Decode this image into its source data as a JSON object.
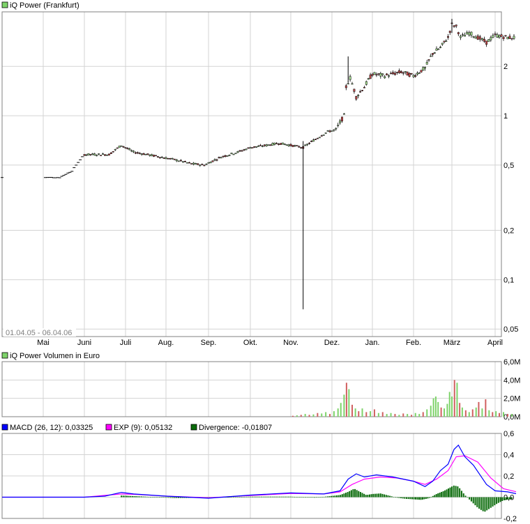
{
  "colors": {
    "grid": "#d3d3d3",
    "frame": "#808080",
    "candle_up": "#a6e08f",
    "candle_down": "#c44a4a",
    "volume_up": "#7ed36a",
    "volume_down": "#d06060",
    "macd": "#0000ff",
    "exp": "#ff00ff",
    "divergence": "#0a6b0a",
    "legend_price": "#7ed36a",
    "legend_volume": "#7ed36a"
  },
  "chart_data": [
    {
      "type": "candlestick",
      "title": "iQ Power (Frankfurt)",
      "date_range": "01.04.05 - 06.04.06",
      "y_scale": "log",
      "y_ticks": [
        {
          "value": 0.05,
          "label": "0,05"
        },
        {
          "value": 0.1,
          "label": "0,1"
        },
        {
          "value": 0.2,
          "label": "0,2"
        },
        {
          "value": 0.5,
          "label": "0,5"
        },
        {
          "value": 1,
          "label": "1"
        },
        {
          "value": 2,
          "label": "2"
        }
      ],
      "ylim": [
        0.045,
        4.3
      ],
      "months": [
        "Mai",
        "Juni",
        "Juli",
        "Aug.",
        "Sep.",
        "Okt.",
        "Nov.",
        "Dez.",
        "Jan.",
        "Feb.",
        "März",
        "April"
      ],
      "price_path": [
        {
          "x": 0,
          "y": 0.42
        },
        {
          "x": 0.4,
          "y": 0.42
        },
        {
          "x": 0.7,
          "y": 0.46
        },
        {
          "x": 1.0,
          "y": 0.58
        },
        {
          "x": 1.3,
          "y": 0.58
        },
        {
          "x": 1.6,
          "y": 0.58
        },
        {
          "x": 1.9,
          "y": 0.66
        },
        {
          "x": 2.2,
          "y": 0.6
        },
        {
          "x": 2.7,
          "y": 0.57
        },
        {
          "x": 3.2,
          "y": 0.54
        },
        {
          "x": 3.6,
          "y": 0.51
        },
        {
          "x": 3.9,
          "y": 0.5
        },
        {
          "x": 4.3,
          "y": 0.56
        },
        {
          "x": 4.7,
          "y": 0.6
        },
        {
          "x": 5.0,
          "y": 0.64
        },
        {
          "x": 5.4,
          "y": 0.66
        },
        {
          "x": 5.7,
          "y": 0.68
        },
        {
          "x": 6.0,
          "y": 0.66
        },
        {
          "x": 6.3,
          "y": 0.64
        },
        {
          "x": 6.6,
          "y": 0.72
        },
        {
          "x": 6.9,
          "y": 0.8
        },
        {
          "x": 7.1,
          "y": 0.82
        },
        {
          "x": 7.3,
          "y": 1.0
        },
        {
          "x": 7.35,
          "y": 1.5
        },
        {
          "x": 7.45,
          "y": 1.7
        },
        {
          "x": 7.6,
          "y": 1.3
        },
        {
          "x": 7.8,
          "y": 1.5
        },
        {
          "x": 8.0,
          "y": 1.8
        },
        {
          "x": 8.3,
          "y": 1.75
        },
        {
          "x": 8.7,
          "y": 1.85
        },
        {
          "x": 9.0,
          "y": 1.75
        },
        {
          "x": 9.3,
          "y": 1.95
        },
        {
          "x": 9.5,
          "y": 2.4
        },
        {
          "x": 9.7,
          "y": 2.6
        },
        {
          "x": 9.9,
          "y": 3.0
        },
        {
          "x": 10.0,
          "y": 3.6
        },
        {
          "x": 10.1,
          "y": 3.5
        },
        {
          "x": 10.2,
          "y": 3.0
        },
        {
          "x": 10.4,
          "y": 3.2
        },
        {
          "x": 10.6,
          "y": 3.0
        },
        {
          "x": 10.8,
          "y": 2.8
        },
        {
          "x": 11.0,
          "y": 3.1
        },
        {
          "x": 11.3,
          "y": 3.0
        },
        {
          "x": 11.5,
          "y": 3.0
        }
      ],
      "notable_extremes": {
        "nov_low_spike": 0.066,
        "dec_high_spike": 2.3,
        "mar_high": 3.9
      }
    },
    {
      "type": "bar",
      "title": "iQ Power Volumen in Euro",
      "y_ticks": [
        {
          "value": 0,
          "label": "0,0M"
        },
        {
          "value": 2,
          "label": "2,0M"
        },
        {
          "value": 4,
          "label": "4,0M"
        },
        {
          "value": 6,
          "label": "6,0M"
        }
      ],
      "ylim": [
        0,
        6
      ],
      "bars": [
        {
          "x": 6.05,
          "v": 0.1,
          "up": false
        },
        {
          "x": 6.15,
          "v": 0.15,
          "up": true
        },
        {
          "x": 6.25,
          "v": 0.2,
          "up": false
        },
        {
          "x": 6.35,
          "v": 0.3,
          "up": true
        },
        {
          "x": 6.45,
          "v": 0.2,
          "up": false
        },
        {
          "x": 6.55,
          "v": 0.25,
          "up": true
        },
        {
          "x": 6.65,
          "v": 0.4,
          "up": false
        },
        {
          "x": 6.75,
          "v": 0.35,
          "up": true
        },
        {
          "x": 6.85,
          "v": 0.5,
          "up": true
        },
        {
          "x": 6.95,
          "v": 0.3,
          "up": false
        },
        {
          "x": 7.05,
          "v": 0.6,
          "up": true
        },
        {
          "x": 7.15,
          "v": 0.9,
          "up": true
        },
        {
          "x": 7.22,
          "v": 1.5,
          "up": true
        },
        {
          "x": 7.3,
          "v": 2.4,
          "up": true
        },
        {
          "x": 7.36,
          "v": 3.7,
          "up": false
        },
        {
          "x": 7.42,
          "v": 3.0,
          "up": true
        },
        {
          "x": 7.5,
          "v": 1.3,
          "up": false
        },
        {
          "x": 7.58,
          "v": 0.9,
          "up": true
        },
        {
          "x": 7.66,
          "v": 0.6,
          "up": false
        },
        {
          "x": 7.75,
          "v": 0.9,
          "up": true
        },
        {
          "x": 7.85,
          "v": 0.5,
          "up": false
        },
        {
          "x": 7.95,
          "v": 0.6,
          "up": true
        },
        {
          "x": 8.05,
          "v": 0.8,
          "up": false
        },
        {
          "x": 8.15,
          "v": 0.4,
          "up": true
        },
        {
          "x": 8.25,
          "v": 0.5,
          "up": false
        },
        {
          "x": 8.35,
          "v": 0.3,
          "up": true
        },
        {
          "x": 8.45,
          "v": 0.4,
          "up": true
        },
        {
          "x": 8.55,
          "v": 0.3,
          "up": false
        },
        {
          "x": 8.65,
          "v": 0.2,
          "up": true
        },
        {
          "x": 8.75,
          "v": 0.35,
          "up": false
        },
        {
          "x": 8.85,
          "v": 0.3,
          "up": true
        },
        {
          "x": 8.95,
          "v": 0.2,
          "up": false
        },
        {
          "x": 9.05,
          "v": 0.4,
          "up": true
        },
        {
          "x": 9.15,
          "v": 0.3,
          "up": true
        },
        {
          "x": 9.25,
          "v": 0.5,
          "up": false
        },
        {
          "x": 9.35,
          "v": 0.8,
          "up": true
        },
        {
          "x": 9.45,
          "v": 1.2,
          "up": true
        },
        {
          "x": 9.52,
          "v": 2.0,
          "up": true
        },
        {
          "x": 9.58,
          "v": 2.2,
          "up": true
        },
        {
          "x": 9.64,
          "v": 1.6,
          "up": true
        },
        {
          "x": 9.72,
          "v": 1.0,
          "up": false
        },
        {
          "x": 9.8,
          "v": 0.9,
          "up": true
        },
        {
          "x": 9.88,
          "v": 1.4,
          "up": true
        },
        {
          "x": 9.94,
          "v": 2.7,
          "up": true
        },
        {
          "x": 10.0,
          "v": 2.2,
          "up": true
        },
        {
          "x": 10.06,
          "v": 4.0,
          "up": false
        },
        {
          "x": 10.12,
          "v": 3.7,
          "up": true
        },
        {
          "x": 10.18,
          "v": 1.5,
          "up": false
        },
        {
          "x": 10.24,
          "v": 1.0,
          "up": true
        },
        {
          "x": 10.32,
          "v": 0.7,
          "up": false
        },
        {
          "x": 10.4,
          "v": 0.5,
          "up": true
        },
        {
          "x": 10.48,
          "v": 0.8,
          "up": false
        },
        {
          "x": 10.56,
          "v": 1.0,
          "up": true
        },
        {
          "x": 10.62,
          "v": 1.6,
          "up": false
        },
        {
          "x": 10.7,
          "v": 0.9,
          "up": true
        },
        {
          "x": 10.78,
          "v": 1.9,
          "up": false
        },
        {
          "x": 10.86,
          "v": 0.7,
          "up": true
        },
        {
          "x": 10.94,
          "v": 0.5,
          "up": false
        },
        {
          "x": 11.02,
          "v": 0.6,
          "up": true
        },
        {
          "x": 11.1,
          "v": 0.4,
          "up": false
        },
        {
          "x": 11.2,
          "v": 0.5,
          "up": true
        },
        {
          "x": 11.3,
          "v": 0.3,
          "up": false
        },
        {
          "x": 11.4,
          "v": 0.3,
          "up": true
        }
      ]
    },
    {
      "type": "line",
      "y_ticks": [
        {
          "value": -0.2,
          "label": "-0,2"
        },
        {
          "value": 0,
          "label": "0,0"
        },
        {
          "value": 0.2,
          "label": "0,2"
        },
        {
          "value": 0.4,
          "label": "0,4"
        },
        {
          "value": 0.6,
          "label": "0,6"
        }
      ],
      "ylim": [
        -0.2,
        0.6
      ],
      "legend": [
        {
          "label": "MACD (26, 12): 0,03325",
          "color": "#0000ff"
        },
        {
          "label": "EXP (9): 0,05132",
          "color": "#ff00ff"
        },
        {
          "label": "Divergence: -0,01807",
          "color": "#0a6b0a"
        }
      ],
      "series": [
        {
          "name": "MACD (26, 12)",
          "points": [
            {
              "x": 0,
              "y": 0.0
            },
            {
              "x": 1.0,
              "y": 0.0
            },
            {
              "x": 1.5,
              "y": 0.01
            },
            {
              "x": 1.9,
              "y": 0.045
            },
            {
              "x": 2.2,
              "y": 0.03
            },
            {
              "x": 3.0,
              "y": 0.01
            },
            {
              "x": 4.0,
              "y": -0.01
            },
            {
              "x": 5.0,
              "y": 0.02
            },
            {
              "x": 6.0,
              "y": 0.04
            },
            {
              "x": 6.8,
              "y": 0.03
            },
            {
              "x": 7.2,
              "y": 0.06
            },
            {
              "x": 7.4,
              "y": 0.17
            },
            {
              "x": 7.6,
              "y": 0.22
            },
            {
              "x": 7.8,
              "y": 0.19
            },
            {
              "x": 8.1,
              "y": 0.21
            },
            {
              "x": 8.5,
              "y": 0.19
            },
            {
              "x": 9.0,
              "y": 0.15
            },
            {
              "x": 9.3,
              "y": 0.1
            },
            {
              "x": 9.5,
              "y": 0.15
            },
            {
              "x": 9.7,
              "y": 0.25
            },
            {
              "x": 9.9,
              "y": 0.31
            },
            {
              "x": 10.05,
              "y": 0.45
            },
            {
              "x": 10.15,
              "y": 0.49
            },
            {
              "x": 10.3,
              "y": 0.38
            },
            {
              "x": 10.5,
              "y": 0.3
            },
            {
              "x": 10.8,
              "y": 0.12
            },
            {
              "x": 11.0,
              "y": 0.06
            },
            {
              "x": 11.3,
              "y": 0.05
            },
            {
              "x": 11.5,
              "y": 0.033
            }
          ]
        },
        {
          "name": "EXP (9)",
          "points": [
            {
              "x": 0,
              "y": 0.0
            },
            {
              "x": 1.0,
              "y": 0.0
            },
            {
              "x": 1.9,
              "y": 0.03
            },
            {
              "x": 2.3,
              "y": 0.025
            },
            {
              "x": 3.0,
              "y": 0.01
            },
            {
              "x": 4.0,
              "y": -0.005
            },
            {
              "x": 5.0,
              "y": 0.015
            },
            {
              "x": 6.0,
              "y": 0.035
            },
            {
              "x": 6.8,
              "y": 0.03
            },
            {
              "x": 7.2,
              "y": 0.05
            },
            {
              "x": 7.5,
              "y": 0.12
            },
            {
              "x": 7.8,
              "y": 0.17
            },
            {
              "x": 8.2,
              "y": 0.19
            },
            {
              "x": 8.6,
              "y": 0.18
            },
            {
              "x": 9.0,
              "y": 0.15
            },
            {
              "x": 9.3,
              "y": 0.12
            },
            {
              "x": 9.6,
              "y": 0.17
            },
            {
              "x": 9.9,
              "y": 0.25
            },
            {
              "x": 10.1,
              "y": 0.38
            },
            {
              "x": 10.3,
              "y": 0.39
            },
            {
              "x": 10.6,
              "y": 0.33
            },
            {
              "x": 10.9,
              "y": 0.18
            },
            {
              "x": 11.2,
              "y": 0.08
            },
            {
              "x": 11.5,
              "y": 0.051
            }
          ]
        },
        {
          "name": "Divergence",
          "type": "bar",
          "points": [
            {
              "x": 1.9,
              "y": 0.015
            },
            {
              "x": 2.5,
              "y": 0.005
            },
            {
              "x": 3.2,
              "y": -0.008
            },
            {
              "x": 4.0,
              "y": -0.005
            },
            {
              "x": 5.0,
              "y": 0.005
            },
            {
              "x": 6.0,
              "y": 0.005
            },
            {
              "x": 6.6,
              "y": -0.005
            },
            {
              "x": 7.2,
              "y": 0.02
            },
            {
              "x": 7.4,
              "y": 0.05
            },
            {
              "x": 7.55,
              "y": 0.08
            },
            {
              "x": 7.7,
              "y": 0.05
            },
            {
              "x": 7.85,
              "y": 0.02
            },
            {
              "x": 8.0,
              "y": 0.03
            },
            {
              "x": 8.2,
              "y": 0.035
            },
            {
              "x": 8.4,
              "y": 0.015
            },
            {
              "x": 8.6,
              "y": -0.005
            },
            {
              "x": 8.8,
              "y": -0.015
            },
            {
              "x": 9.0,
              "y": -0.02
            },
            {
              "x": 9.2,
              "y": -0.025
            },
            {
              "x": 9.4,
              "y": -0.01
            },
            {
              "x": 9.6,
              "y": 0.03
            },
            {
              "x": 9.8,
              "y": 0.06
            },
            {
              "x": 9.95,
              "y": 0.09
            },
            {
              "x": 10.05,
              "y": 0.11
            },
            {
              "x": 10.15,
              "y": 0.1
            },
            {
              "x": 10.3,
              "y": 0.02
            },
            {
              "x": 10.45,
              "y": -0.04
            },
            {
              "x": 10.6,
              "y": -0.1
            },
            {
              "x": 10.75,
              "y": -0.14
            },
            {
              "x": 10.9,
              "y": -0.1
            },
            {
              "x": 11.05,
              "y": -0.06
            },
            {
              "x": 11.2,
              "y": -0.03
            },
            {
              "x": 11.4,
              "y": -0.018
            }
          ]
        }
      ]
    }
  ]
}
